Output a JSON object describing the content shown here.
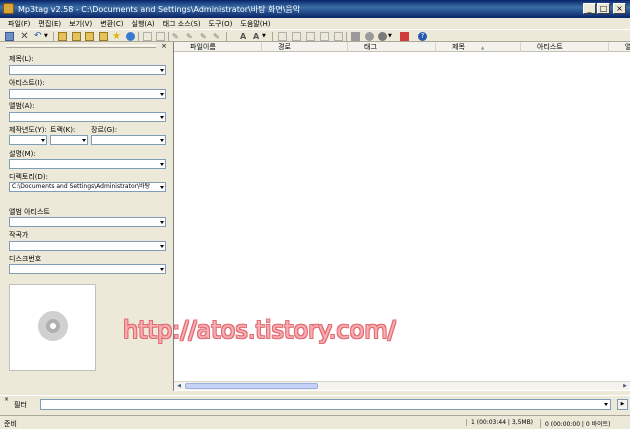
{
  "window": {
    "title": "Mp3tag v2.58  -  C:\\Documents and Settings\\Administrator\\바탕 화면\\음악",
    "minimize": "_",
    "maximize": "□",
    "close": "×"
  },
  "menu": [
    "파일(F)",
    "편집(E)",
    "보기(V)",
    "변환(C)",
    "실행(A)",
    "태그 소스(S)",
    "도구(O)",
    "도움말(H)"
  ],
  "tag_panel": {
    "close": "×",
    "fields": {
      "title": "제목(L):",
      "artist": "아티스트(I):",
      "album": "앨범(A):",
      "year": "제작년도(Y):",
      "track": "트랙(K):",
      "genre": "장르(G):",
      "comment": "설명(M):",
      "directory": "디렉토리(D):",
      "album_artist": "앨범 아티스트",
      "composer": "작곡가",
      "disc": "디스크번호"
    },
    "directory_value": "C:\\Documents and Settings\\Administrator\\바탕"
  },
  "file_list": {
    "columns": [
      "파일이름",
      "경로",
      "태그",
      "제목",
      "아티스트",
      "앨"
    ],
    "sort_indicator": "▲"
  },
  "watermark": "http://atos.tistory.com/",
  "filter": {
    "close": "×",
    "label": "필터",
    "go": "▶"
  },
  "status": {
    "ready": "준비",
    "selected": "1 (00:03:44 | 3,5MB)",
    "zero": "0 (00:00:00 | 0 바이트)"
  }
}
